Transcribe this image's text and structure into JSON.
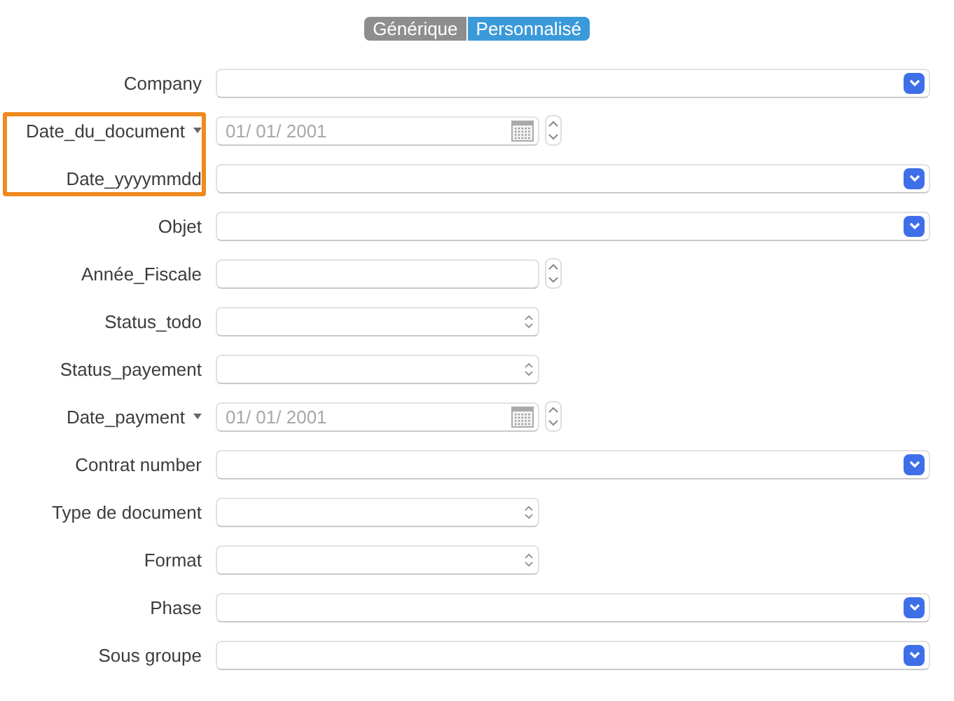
{
  "mode_switch": [
    {
      "label": "Générique",
      "selected": false
    },
    {
      "label": "Personnalisé",
      "selected": true
    }
  ],
  "fields": [
    {
      "label": "Company",
      "kind": "combo",
      "highlighted": false,
      "label_menu": false
    },
    {
      "label": "Date_du_document",
      "kind": "date",
      "placeholder": "01/ 01/ 2001",
      "highlighted": true,
      "label_menu": true
    },
    {
      "label": "Date_yyyymmdd",
      "kind": "combo",
      "highlighted": true,
      "label_menu": false
    },
    {
      "label": "Objet",
      "kind": "combo",
      "highlighted": false,
      "label_menu": false
    },
    {
      "label": "Année_Fiscale",
      "kind": "number",
      "highlighted": false,
      "label_menu": false
    },
    {
      "label": "Status_todo",
      "kind": "popup",
      "highlighted": false,
      "label_menu": false
    },
    {
      "label": "Status_payement",
      "kind": "popup",
      "highlighted": false,
      "label_menu": false
    },
    {
      "label": "Date_payment",
      "kind": "date",
      "placeholder": "01/ 01/ 2001",
      "highlighted": false,
      "label_menu": true
    },
    {
      "label": "Contrat number",
      "kind": "combo",
      "highlighted": false,
      "label_menu": false
    },
    {
      "label": "Type de document",
      "kind": "popup",
      "highlighted": false,
      "label_menu": false
    },
    {
      "label": "Format",
      "kind": "popup",
      "highlighted": false,
      "label_menu": false
    },
    {
      "label": "Phase",
      "kind": "combo",
      "highlighted": false,
      "label_menu": false
    },
    {
      "label": "Sous groupe",
      "kind": "combo",
      "highlighted": false,
      "label_menu": false
    }
  ]
}
